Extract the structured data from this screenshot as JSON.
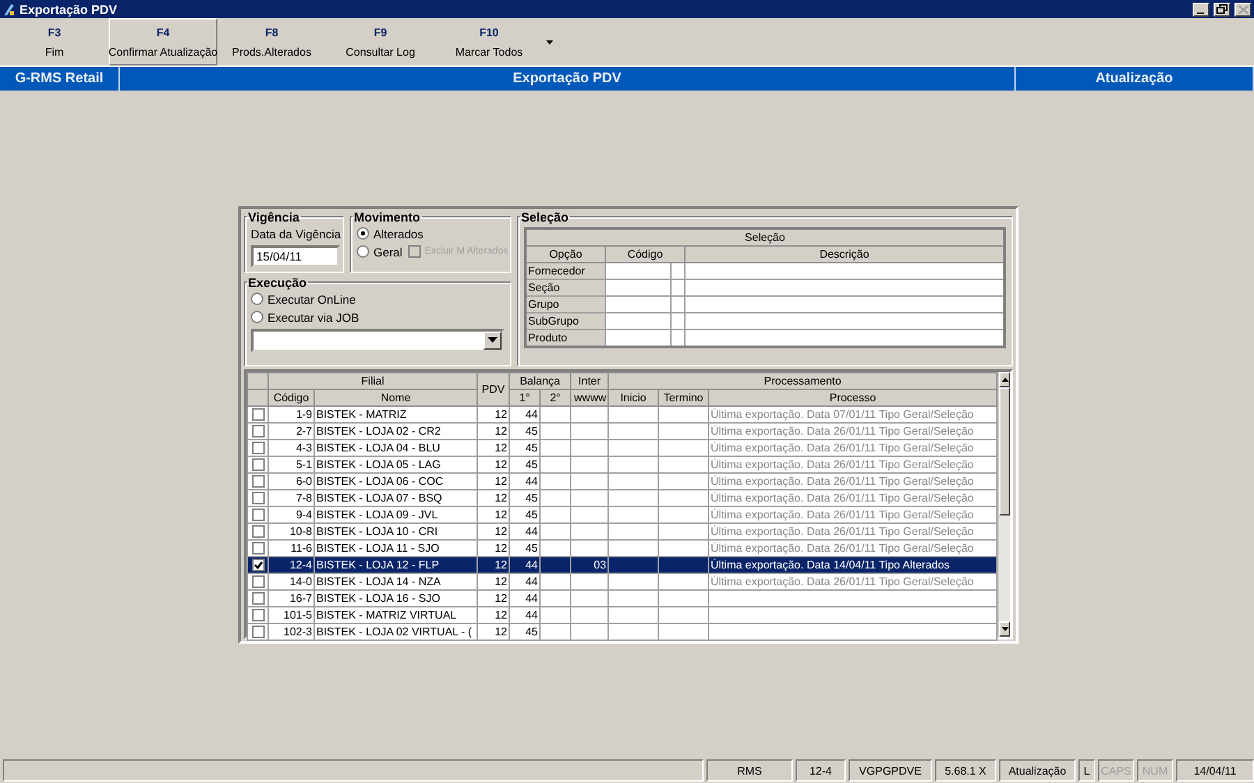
{
  "window": {
    "title": "Exportação PDV",
    "close_disabled": true
  },
  "toolbar": [
    {
      "key": "F3",
      "label": "Fim",
      "pressed": false
    },
    {
      "key": "F4",
      "label": "Confirmar Atualização",
      "pressed": true
    },
    {
      "key": "F8",
      "label": "Prods.Alterados",
      "pressed": false
    },
    {
      "key": "F9",
      "label": "Consultar Log",
      "pressed": false
    },
    {
      "key": "F10",
      "label": "Marcar Todos",
      "pressed": false
    }
  ],
  "header_bar": [
    "G-RMS Retail",
    "Exportação PDV",
    "Atualização"
  ],
  "vigencia": {
    "title": "Vigência",
    "label": "Data da Vigência",
    "value": "15/04/11"
  },
  "movimento": {
    "title": "Movimento",
    "options": [
      {
        "label": "Alterados",
        "selected": true
      },
      {
        "label": "Geral",
        "selected": false
      }
    ],
    "exclude": {
      "label": "Excluir M Alterados",
      "checked": false,
      "disabled": true
    }
  },
  "execucao": {
    "title": "Execução",
    "options": [
      {
        "label": "Executar OnLine",
        "selected": false
      },
      {
        "label": "Executar via JOB",
        "selected": false
      }
    ]
  },
  "selecao": {
    "title": "Seleção",
    "table_title": "Seleção",
    "columns": [
      "Opção",
      "Código",
      "Descrição"
    ],
    "rows": [
      "Fornecedor",
      "Seção",
      "Grupo",
      "SubGrupo",
      "Produto"
    ]
  },
  "grid": {
    "groups": [
      "Filial",
      "PDV",
      "Balança",
      "Inter",
      "Processamento"
    ],
    "columns": [
      "Código",
      "Nome",
      "1°",
      "2°",
      "wwww",
      "Inicio",
      "Termino",
      "Processo"
    ],
    "rows": [
      {
        "checked": false,
        "selected": false,
        "codigo": "1-9",
        "nome": "BISTEK - MATRIZ",
        "pdv": "12",
        "b1": "44",
        "processo": "Última exportação. Data 07/01/11 Tipo Geral/Seleção"
      },
      {
        "checked": false,
        "selected": false,
        "codigo": "2-7",
        "nome": "BISTEK - LOJA 02 - CR2",
        "pdv": "12",
        "b1": "45",
        "processo": "Última exportação. Data 26/01/11 Tipo Geral/Seleção"
      },
      {
        "checked": false,
        "selected": false,
        "codigo": "4-3",
        "nome": "BISTEK - LOJA 04 -  BLU",
        "pdv": "12",
        "b1": "45",
        "processo": "Última exportação. Data 26/01/11 Tipo Geral/Seleção"
      },
      {
        "checked": false,
        "selected": false,
        "codigo": "5-1",
        "nome": "BISTEK - LOJA 05 - LAG",
        "pdv": "12",
        "b1": "45",
        "processo": "Última exportação. Data 26/01/11 Tipo Geral/Seleção"
      },
      {
        "checked": false,
        "selected": false,
        "codigo": "6-0",
        "nome": "BISTEK - LOJA 06 - COC",
        "pdv": "12",
        "b1": "44",
        "processo": "Última exportação. Data 26/01/11 Tipo Geral/Seleção"
      },
      {
        "checked": false,
        "selected": false,
        "codigo": "7-8",
        "nome": "BISTEK - LOJA 07 - BSQ",
        "pdv": "12",
        "b1": "45",
        "processo": "Última exportação. Data 26/01/11 Tipo Geral/Seleção"
      },
      {
        "checked": false,
        "selected": false,
        "codigo": "9-4",
        "nome": "BISTEK - LOJA 09 - JVL",
        "pdv": "12",
        "b1": "45",
        "processo": "Última exportação. Data 26/01/11 Tipo Geral/Seleção"
      },
      {
        "checked": false,
        "selected": false,
        "codigo": "10-8",
        "nome": "BISTEK - LOJA 10 - CRI",
        "pdv": "12",
        "b1": "44",
        "processo": "Última exportação. Data 26/01/11 Tipo Geral/Seleção"
      },
      {
        "checked": false,
        "selected": false,
        "codigo": "11-6",
        "nome": "BISTEK - LOJA 11 - SJO",
        "pdv": "12",
        "b1": "45",
        "processo": "Última exportação. Data 26/01/11 Tipo Geral/Seleção"
      },
      {
        "checked": true,
        "selected": true,
        "codigo": "12-4",
        "nome": "BISTEK - LOJA 12 - FLP",
        "pdv": "12",
        "b1": "44",
        "inter": "03",
        "processo": "Última exportação. Data 14/04/11 Tipo Alterados"
      },
      {
        "checked": false,
        "selected": false,
        "codigo": "14-0",
        "nome": "BISTEK - LOJA 14 - NZA",
        "pdv": "12",
        "b1": "44",
        "processo": "Última exportação. Data 26/01/11 Tipo Geral/Seleção"
      },
      {
        "checked": false,
        "selected": false,
        "codigo": "16-7",
        "nome": "BISTEK - LOJA 16 - SJO",
        "pdv": "12",
        "b1": "44"
      },
      {
        "checked": false,
        "selected": false,
        "codigo": "101-5",
        "nome": "BISTEK - MATRIZ VIRTUAL",
        "pdv": "12",
        "b1": "44"
      },
      {
        "checked": false,
        "selected": false,
        "codigo": "102-3",
        "nome": "BISTEK - LOJA 02 VIRTUAL - (",
        "pdv": "12",
        "b1": "45"
      }
    ]
  },
  "status_bar": [
    {
      "text": "RMS",
      "disabled": false
    },
    {
      "text": "12-4",
      "disabled": false
    },
    {
      "text": "VGPGPDVE",
      "disabled": false
    },
    {
      "text": "5.68.1 X",
      "disabled": false
    },
    {
      "text": "Atualização",
      "disabled": false
    },
    {
      "text": "L",
      "disabled": false
    },
    {
      "text": "CAPS",
      "disabled": true
    },
    {
      "text": "NUM",
      "disabled": true
    },
    {
      "text": "14/04/11",
      "disabled": false
    }
  ]
}
